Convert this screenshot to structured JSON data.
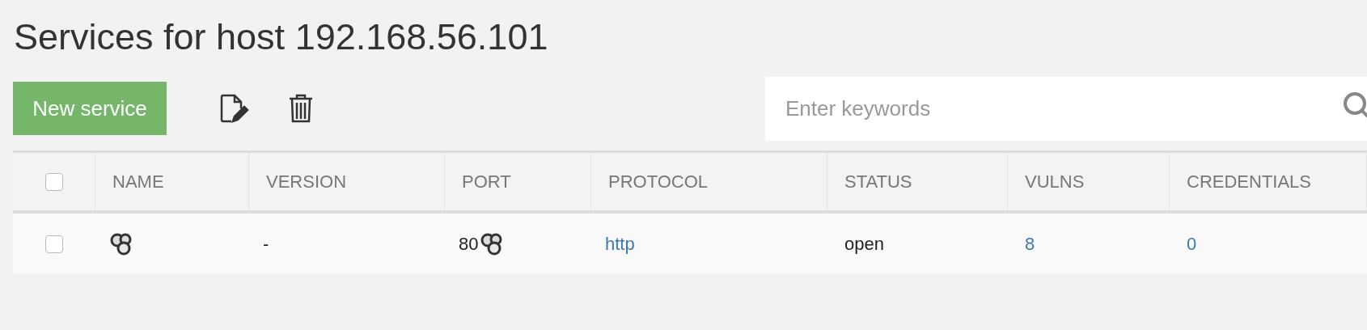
{
  "title": "Services for host 192.168.56.101",
  "toolbar": {
    "new_button": "New service"
  },
  "search": {
    "placeholder": "Enter keywords"
  },
  "table": {
    "select_all": {
      "checked": false
    },
    "columns": [
      "NAME",
      "VERSION",
      "PORT",
      "PROTOCOL",
      "STATUS",
      "VULNS",
      "CREDENTIALS"
    ],
    "rows": [
      {
        "checked": false,
        "version": "-",
        "port": "80",
        "protocol": "http",
        "status": "open",
        "vulns": "8",
        "credentials": "0"
      }
    ]
  }
}
